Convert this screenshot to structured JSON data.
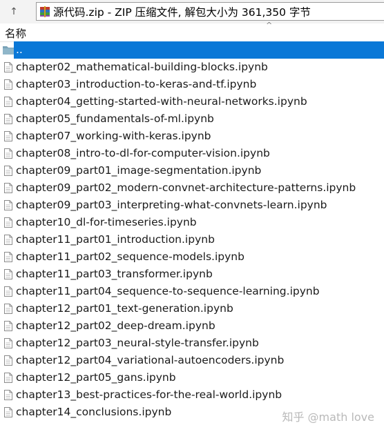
{
  "toolbar": {
    "up_glyph": "↑",
    "path": "源代码.zip - ZIP 压缩文件, 解包大小为 361,350 字节"
  },
  "header": {
    "name_column": "名称",
    "sort_glyph": "^"
  },
  "rows": [
    {
      "name": "..",
      "type": "folder",
      "selected": true
    },
    {
      "name": "chapter02_mathematical-building-blocks.ipynb",
      "type": "file"
    },
    {
      "name": "chapter03_introduction-to-keras-and-tf.ipynb",
      "type": "file"
    },
    {
      "name": "chapter04_getting-started-with-neural-networks.ipynb",
      "type": "file"
    },
    {
      "name": "chapter05_fundamentals-of-ml.ipynb",
      "type": "file"
    },
    {
      "name": "chapter07_working-with-keras.ipynb",
      "type": "file"
    },
    {
      "name": "chapter08_intro-to-dl-for-computer-vision.ipynb",
      "type": "file"
    },
    {
      "name": "chapter09_part01_image-segmentation.ipynb",
      "type": "file"
    },
    {
      "name": "chapter09_part02_modern-convnet-architecture-patterns.ipynb",
      "type": "file"
    },
    {
      "name": "chapter09_part03_interpreting-what-convnets-learn.ipynb",
      "type": "file"
    },
    {
      "name": "chapter10_dl-for-timeseries.ipynb",
      "type": "file"
    },
    {
      "name": "chapter11_part01_introduction.ipynb",
      "type": "file"
    },
    {
      "name": "chapter11_part02_sequence-models.ipynb",
      "type": "file"
    },
    {
      "name": "chapter11_part03_transformer.ipynb",
      "type": "file"
    },
    {
      "name": "chapter11_part04_sequence-to-sequence-learning.ipynb",
      "type": "file"
    },
    {
      "name": "chapter12_part01_text-generation.ipynb",
      "type": "file"
    },
    {
      "name": "chapter12_part02_deep-dream.ipynb",
      "type": "file"
    },
    {
      "name": "chapter12_part03_neural-style-transfer.ipynb",
      "type": "file"
    },
    {
      "name": "chapter12_part04_variational-autoencoders.ipynb",
      "type": "file"
    },
    {
      "name": "chapter12_part05_gans.ipynb",
      "type": "file"
    },
    {
      "name": "chapter13_best-practices-for-the-real-world.ipynb",
      "type": "file"
    },
    {
      "name": "chapter14_conclusions.ipynb",
      "type": "file"
    }
  ],
  "watermark": "知乎 @math love",
  "colors": {
    "selection": "#0a78d7",
    "folder": "#7aa3b8",
    "rar_red": "#c0392b",
    "rar_blue": "#2f6fbf",
    "rar_green": "#3c9a46"
  }
}
